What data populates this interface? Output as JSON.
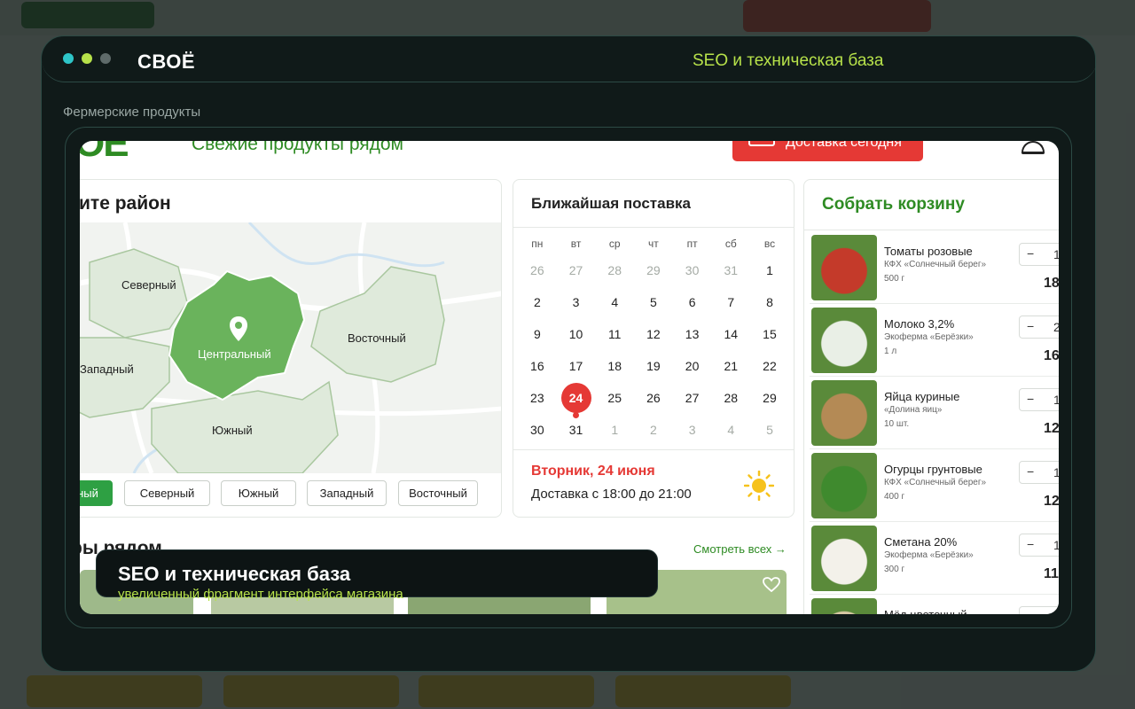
{
  "window": {
    "brand": "СВОЁ",
    "title": "SEO и техническая база",
    "dot_colors": [
      "#2ec5c8",
      "#b7e24a",
      "#5f6b6a"
    ]
  },
  "section_label": "Фермерские продукты",
  "site": {
    "logo": "ОЕ",
    "tagline": "Свежие продукты рядом",
    "delivery_button": "Доставка сегодня"
  },
  "district": {
    "title": "ите район",
    "map_labels": {
      "north": "Северный",
      "center": "Центральный",
      "east": "Восточный",
      "west": "Западный",
      "south": "Южный"
    },
    "chips": [
      {
        "label": "ный",
        "active": true
      },
      {
        "label": "Северный",
        "active": false
      },
      {
        "label": "Южный",
        "active": false
      },
      {
        "label": "Западный",
        "active": false
      },
      {
        "label": "Восточный",
        "active": false
      }
    ]
  },
  "calendar": {
    "title": "Ближайшая поставка",
    "weekdays": [
      "пн",
      "вт",
      "ср",
      "чт",
      "пт",
      "сб",
      "вс"
    ],
    "weeks": [
      [
        "26",
        "27",
        "28",
        "29",
        "30",
        "31",
        "1"
      ],
      [
        "2",
        "3",
        "4",
        "5",
        "6",
        "7",
        "8"
      ],
      [
        "9",
        "10",
        "11",
        "12",
        "13",
        "14",
        "15"
      ],
      [
        "16",
        "17",
        "18",
        "19",
        "20",
        "21",
        "22"
      ],
      [
        "23",
        "24",
        "25",
        "26",
        "27",
        "28",
        "29"
      ],
      [
        "30",
        "31",
        "1",
        "2",
        "3",
        "4",
        "5"
      ]
    ],
    "selected": "24",
    "selected_day": "Вторник, 24 июня",
    "delivery_time": "Доставка с 18:00 до 21:00"
  },
  "basket": {
    "title": "Собрать корзину",
    "items": [
      {
        "name": "Томаты розовые",
        "farm": "КФХ «Солнечный берег»",
        "weight": "500 г",
        "qty": "1",
        "price": "18"
      },
      {
        "name": "Молоко 3,2%",
        "farm": "Экоферма «Берёзки»",
        "weight": "1 л",
        "qty": "2",
        "price": "16"
      },
      {
        "name": "Яйца куриные",
        "farm": "«Долина яиц»",
        "weight": "10 шт.",
        "qty": "1",
        "price": "12"
      },
      {
        "name": "Огурцы грунтовые",
        "farm": "КФХ «Солнечный берег»",
        "weight": "400 г",
        "qty": "1",
        "price": "12"
      },
      {
        "name": "Сметана 20%",
        "farm": "Экоферма «Берёзки»",
        "weight": "300 г",
        "qty": "1",
        "price": "11"
      },
      {
        "name": "Мёд цветочный",
        "farm": "",
        "weight": "",
        "qty": "",
        "price": ""
      }
    ],
    "minus": "−"
  },
  "farmers": {
    "title": "ры рядом",
    "see_all": "Смотреть всех →"
  },
  "caption": {
    "title": "SEO и техническая база",
    "subtitle": "увеличенный фрагмент интерфейса магазина"
  }
}
